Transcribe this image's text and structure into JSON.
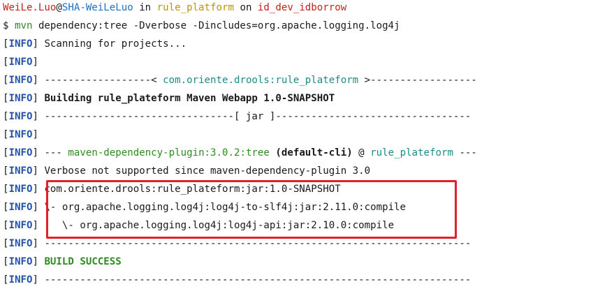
{
  "prompt": {
    "user": "WeiLe.Luo",
    "at": "@",
    "host": "SHA-WeiLeLuo",
    "in_word": " in ",
    "dir": "rule_platform",
    "on_word": " on ",
    "branch": "id_dev_idborrow"
  },
  "command": {
    "dollar": "$ ",
    "program": "mvn",
    "args": " dependency:tree -Dverbose -Dincludes=org.apache.logging.log4j"
  },
  "info_tag": {
    "open": "[",
    "text": "INFO",
    "close": "]"
  },
  "output": {
    "scanning": " Scanning for projects...",
    "empty": "",
    "artifact_dashes_left": " ------------------< ",
    "artifact_id": "com.oriente.drools:rule_plateform",
    "artifact_dashes_right": " >------------------",
    "building": " Building rule_plateform Maven Webapp 1.0-SNAPSHOT",
    "jar_line": " --------------------------------[ jar ]---------------------------------",
    "plugin_prefix": " --- ",
    "plugin_name": "maven-dependency-plugin:3.0.2:tree",
    "plugin_exec": " (default-cli)",
    "plugin_at": " @ ",
    "plugin_project": "rule_plateform",
    "plugin_suffix": " ---",
    "verbose": " Verbose not supported since maven-dependency-plugin 3.0",
    "tree_root": " com.oriente.drools:rule_plateform:jar:1.0-SNAPSHOT",
    "tree_child": " \\- org.apache.logging.log4j:log4j-to-slf4j:jar:2.11.0:compile",
    "tree_grandchild": "    \\- org.apache.logging.log4j:log4j-api:jar:2.10.0:compile",
    "separator": " ------------------------------------------------------------------------",
    "build_success": " BUILD SUCCESS",
    "separator2": " ------------------------------------------------------------------------"
  },
  "colors": {
    "user": "#c4221b",
    "host": "#1f6fc4",
    "dir": "#b89800",
    "branch": "#c4221b",
    "program": "#2e8b1f",
    "info": "#2352a8",
    "artifact": "#1d8b86",
    "plugin": "#2e8b1f",
    "success": "#2e8b1f",
    "highlight_border": "#e0202a"
  }
}
